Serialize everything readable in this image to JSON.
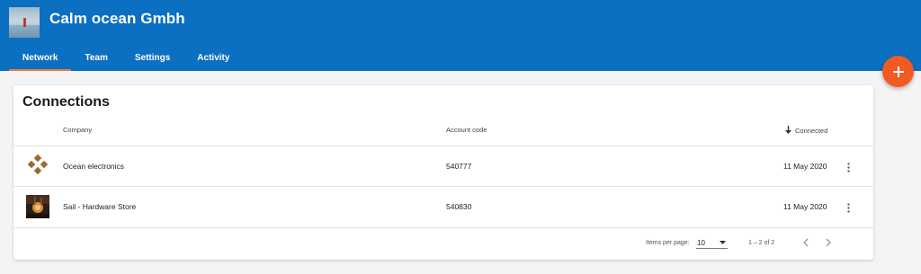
{
  "header": {
    "org_name": "Calm ocean Gmbh",
    "org_avatar_icon": "sailboat-ocean-photo",
    "brand_color": "#0b6fc2",
    "tabs": [
      {
        "label": "Network",
        "active": true
      },
      {
        "label": "Team",
        "active": false
      },
      {
        "label": "Settings",
        "active": false
      },
      {
        "label": "Activity",
        "active": false
      }
    ],
    "active_tab_indicator_color": "#f47a3c"
  },
  "fab": {
    "icon": "plus-icon",
    "color": "#f15a22"
  },
  "connections": {
    "title": "Connections",
    "columns": {
      "company": "Company",
      "account_code": "Account code",
      "connected": "Connected",
      "connected_sort_icon": "arrow-down-icon"
    },
    "rows": [
      {
        "logo": "diamond-pattern-logo",
        "company": "Ocean electronics",
        "account_code": "540777",
        "connected": "11 May 2020",
        "menu_icon": "more-vertical-icon"
      },
      {
        "logo": "hardware-store-photo",
        "company": "Sail - Hardware Store",
        "account_code": "540830",
        "connected": "11 May 2020",
        "menu_icon": "more-vertical-icon"
      }
    ],
    "pagination": {
      "items_per_page_label": "Items per page:",
      "items_per_page_value": "10",
      "range": "1 – 2 of 2",
      "prev_icon": "chevron-left-icon",
      "next_icon": "chevron-right-icon"
    }
  }
}
